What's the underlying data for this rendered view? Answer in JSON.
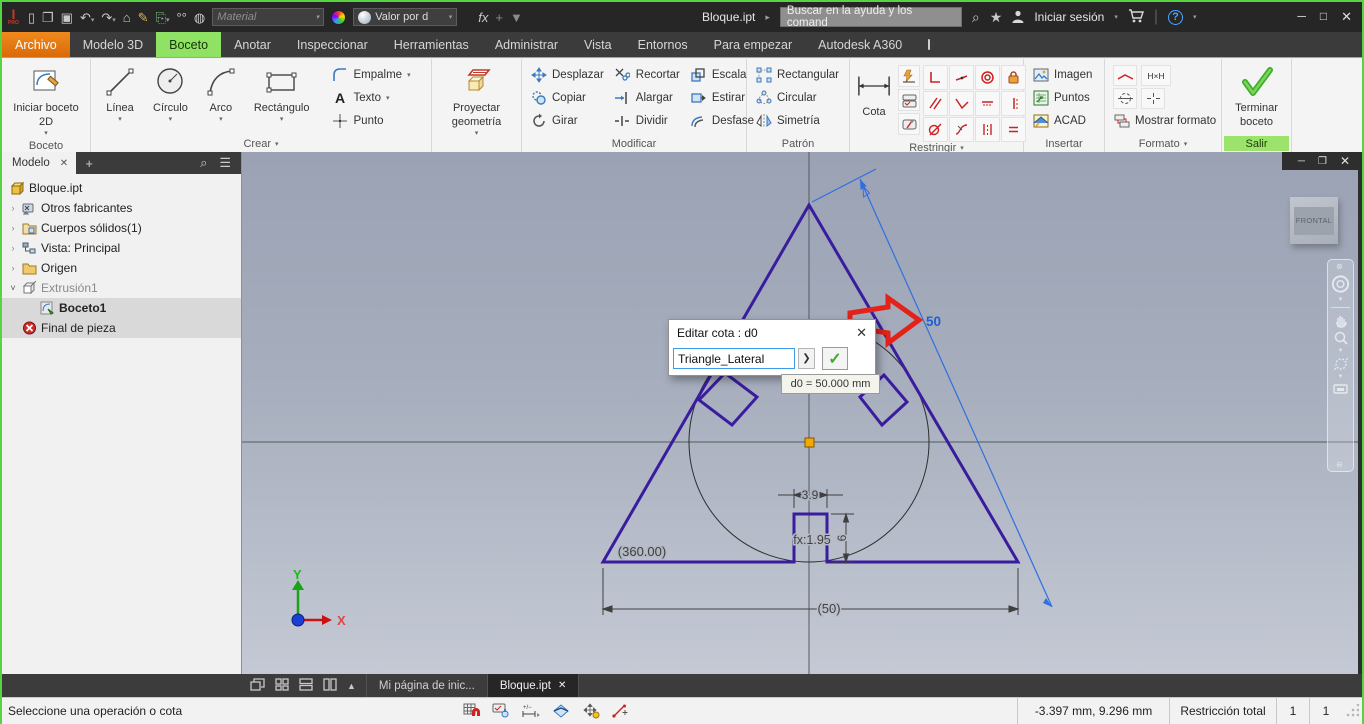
{
  "titlebar": {
    "app_badge": "PRO",
    "material_dropdown": "Material",
    "appearance_dropdown": "Valor por d",
    "fx_label": "fx",
    "title": "Bloque.ipt",
    "search_placeholder": "Buscar en la ayuda y los comand",
    "sign_in": "Iniciar sesión"
  },
  "tabs": {
    "items": [
      {
        "label": "Archivo"
      },
      {
        "label": "Modelo 3D"
      },
      {
        "label": "Boceto"
      },
      {
        "label": "Anotar"
      },
      {
        "label": "Inspeccionar"
      },
      {
        "label": "Herramientas"
      },
      {
        "label": "Administrar"
      },
      {
        "label": "Vista"
      },
      {
        "label": "Entornos"
      },
      {
        "label": "Para empezar"
      },
      {
        "label": "Autodesk A360"
      }
    ]
  },
  "ribbon": {
    "boceto": {
      "button": "Iniciar boceto 2D",
      "label": "Boceto"
    },
    "crear": {
      "big": [
        {
          "label": "Línea"
        },
        {
          "label": "Círculo"
        },
        {
          "label": "Arco"
        },
        {
          "label": "Rectángulo"
        }
      ],
      "small": [
        {
          "label": "Empalme"
        },
        {
          "label": "Texto"
        },
        {
          "label": "Punto"
        }
      ],
      "label": "Crear"
    },
    "proyectar": {
      "button": "Proyectar geometría"
    },
    "modificar": {
      "items": [
        {
          "label": "Desplazar"
        },
        {
          "label": "Copiar"
        },
        {
          "label": "Girar"
        },
        {
          "label": "Recortar"
        },
        {
          "label": "Alargar"
        },
        {
          "label": "Dividir"
        },
        {
          "label": "Escala"
        },
        {
          "label": "Estirar"
        },
        {
          "label": "Desfase"
        }
      ],
      "label": "Modificar"
    },
    "patron": {
      "items": [
        {
          "label": "Rectangular"
        },
        {
          "label": "Circular"
        },
        {
          "label": "Simetría"
        }
      ],
      "label": "Patrón"
    },
    "restringir": {
      "cota": "Cota",
      "label": "Restringir"
    },
    "insertar": {
      "items": [
        {
          "label": "Imagen"
        },
        {
          "label": "Puntos"
        },
        {
          "label": "ACAD"
        }
      ],
      "label": "Insertar"
    },
    "formato": {
      "mostrar": "Mostrar formato",
      "hxh": "H×H",
      "label": "Formato"
    },
    "salir": {
      "terminar": "Terminar boceto",
      "label": "Salir"
    }
  },
  "browser": {
    "tab": "Modelo",
    "items": [
      {
        "label": "Bloque.ipt"
      },
      {
        "label": "Otros fabricantes"
      },
      {
        "label": "Cuerpos sólidos(1)"
      },
      {
        "label": "Vista: Principal"
      },
      {
        "label": "Origen"
      },
      {
        "label": "Extrusión1"
      },
      {
        "label": "Boceto1"
      },
      {
        "label": "Final de pieza"
      }
    ]
  },
  "canvas": {
    "dialog": {
      "title": "Editar cota : d0",
      "input_value": "Triangle_Lateral"
    },
    "tooltip": "d0 = 50.000 mm",
    "viewcube": "FRONTAL",
    "dims": {
      "lateral": "50",
      "base": "(50)",
      "angle": "(360.00)",
      "notch_width": "3.9",
      "notch_height": "6",
      "fx": "fx:1.95"
    },
    "axes": {
      "x": "X",
      "y": "Y"
    }
  },
  "dock": {
    "tabs": [
      {
        "label": "Mi página de inic..."
      },
      {
        "label": "Bloque.ipt"
      }
    ]
  },
  "statusbar": {
    "message": "Seleccione una operación o cota",
    "coords": "-3.397 mm, 9.296 mm",
    "constraint": "Restricción total",
    "count1": "1",
    "count2": "1"
  },
  "colors": {
    "window_border": "#57d441",
    "tab_active_green": "#8fe263",
    "archivo_orange": "#e8760d",
    "sketch_purple": "#3a1d9e",
    "dimension_blue": "#2f6fe0",
    "annotation_red": "#e32219"
  }
}
